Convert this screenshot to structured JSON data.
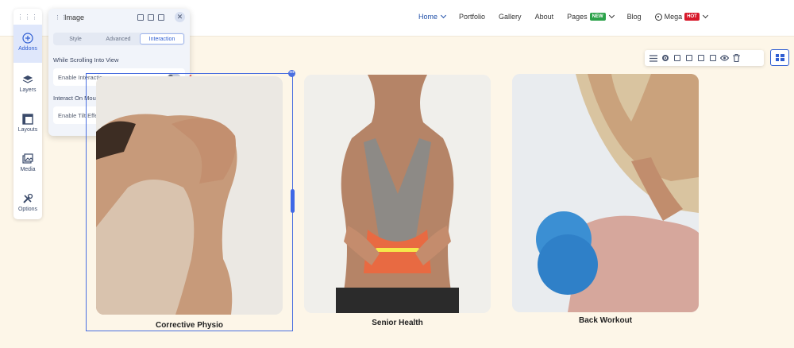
{
  "nav": {
    "items": [
      {
        "label": "Home",
        "has_caret": true,
        "active": true
      },
      {
        "label": "Portfolio"
      },
      {
        "label": "Gallery"
      },
      {
        "label": "About"
      },
      {
        "label": "Pages",
        "badge": "NEW",
        "has_caret": true
      },
      {
        "label": "Blog"
      },
      {
        "label": "Mega",
        "badge": "HOT",
        "has_caret": true,
        "icon": "mega-icon"
      }
    ]
  },
  "sidebar": {
    "items": [
      {
        "label": "Addons",
        "icon": "plus-circle-icon",
        "active": true
      },
      {
        "label": "Layers",
        "icon": "layers-icon"
      },
      {
        "label": "Layouts",
        "icon": "layout-icon"
      },
      {
        "label": "Media",
        "icon": "media-icon"
      },
      {
        "label": "Options",
        "icon": "tools-icon"
      }
    ]
  },
  "panel": {
    "title": "Image",
    "tabs": [
      "Style",
      "Advanced",
      "Interaction"
    ],
    "active_tab": "Interaction",
    "sections": [
      {
        "label": "While Scrolling Into View",
        "option": "Enable Interaction",
        "enabled": false
      },
      {
        "label": "Interact On Mouse Movement",
        "option": "Enable Tilt Effect",
        "enabled": false
      }
    ]
  },
  "toolbar": {
    "icons": [
      "rows-icon",
      "gear-icon",
      "save-icon",
      "copy-icon",
      "duplicate-icon",
      "clipboard-icon",
      "eye-icon",
      "trash-icon"
    ],
    "side_icon": "grid-icon"
  },
  "cards": [
    {
      "caption": "Corrective Physio",
      "image": "arm-stretch-photo",
      "selected": true
    },
    {
      "caption": "Senior Health",
      "image": "back-pain-photo"
    },
    {
      "caption": "Back Workout",
      "image": "massage-ball-photo"
    }
  ],
  "colors": {
    "accent": "#2f5ed2",
    "page_bg": "#fdf6e8",
    "badge_new": "#2ca24a",
    "badge_hot": "#d7182a",
    "annotation": "#e03131"
  }
}
